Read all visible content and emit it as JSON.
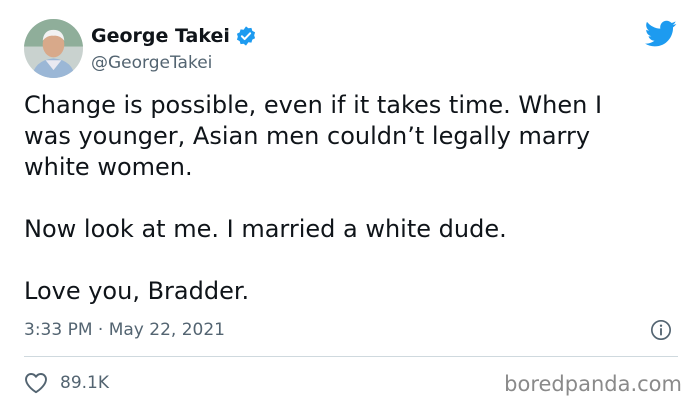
{
  "author": {
    "display_name": "George Takei",
    "handle": "@GeorgeTakei",
    "verified": true
  },
  "tweet": {
    "paragraphs": [
      "Change is possible, even if it takes time. When I\nwas younger, Asian men couldn’t legally marry\nwhite women.",
      "Now look at me. I married a white dude.",
      "Love you, Bradder."
    ],
    "timestamp": "3:33 PM · May 22, 2021",
    "likes": "89.1K"
  },
  "watermark": "boredpanda.com",
  "icons": {
    "brand": "twitter-bird-icon",
    "verified": "verified-badge-icon",
    "info": "info-icon",
    "like": "heart-icon"
  },
  "colors": {
    "twitter_blue": "#1d9bf0",
    "text_primary": "#0f1419",
    "text_secondary": "#536471",
    "divider": "#cfd9de",
    "watermark": "#8a8a8a"
  }
}
